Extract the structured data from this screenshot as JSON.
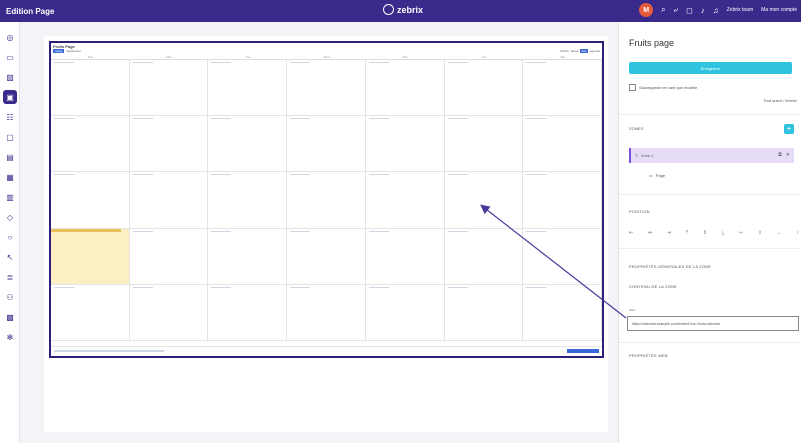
{
  "topbar": {
    "title": "Edition Page",
    "brand": "zebrix",
    "avatar_letter": "M",
    "team_label": "Zebrix team",
    "company_label": "Ma mon compte"
  },
  "leftbar": {
    "icons": [
      "dashboard-icon",
      "monitor-icon",
      "image-icon",
      "page-icon",
      "layout-icon",
      "widget-icon",
      "playlist-icon",
      "calendar-icon",
      "grid-icon",
      "tag-icon",
      "circle-icon",
      "tools-icon",
      "list-icon",
      "users-icon",
      "table-icon",
      "settings-icon"
    ],
    "active_index": 3
  },
  "calendar": {
    "title": "Fruits Page",
    "today_label": "today",
    "month_label": "September",
    "view_labels": [
      "Month",
      "Week",
      "Day",
      "Agenda"
    ],
    "weekdays": [
      "Sun",
      "Mon",
      "Tue",
      "Wed",
      "Thu",
      "Fri",
      "Sat"
    ]
  },
  "panel": {
    "title": "Fruits page",
    "primary_button": "Enregistrer",
    "checkbox_label": "Sauvegarder en tant que modèle",
    "link_right": "Tout ouvrir / fermer",
    "zones_label": "ZONES",
    "add_label": "+",
    "zone_item": "Zone 1",
    "sub_item": "Page",
    "position_label": "POSITION",
    "props_label": "PROPRIÉTÉS GÉNÉRALES DE LA ZONE",
    "content_label": "CONTENU DE LA ZONE",
    "tiny_label": "Web",
    "tooltip_text": "https://calendar.example.com/embed?src=fruits-calendar",
    "advanced_label": "PROPRIÉTÉS WEB"
  },
  "colors": {
    "brand": "#3a2a8c",
    "accent": "#2ec4e0",
    "highlight": "#fbefc3"
  }
}
